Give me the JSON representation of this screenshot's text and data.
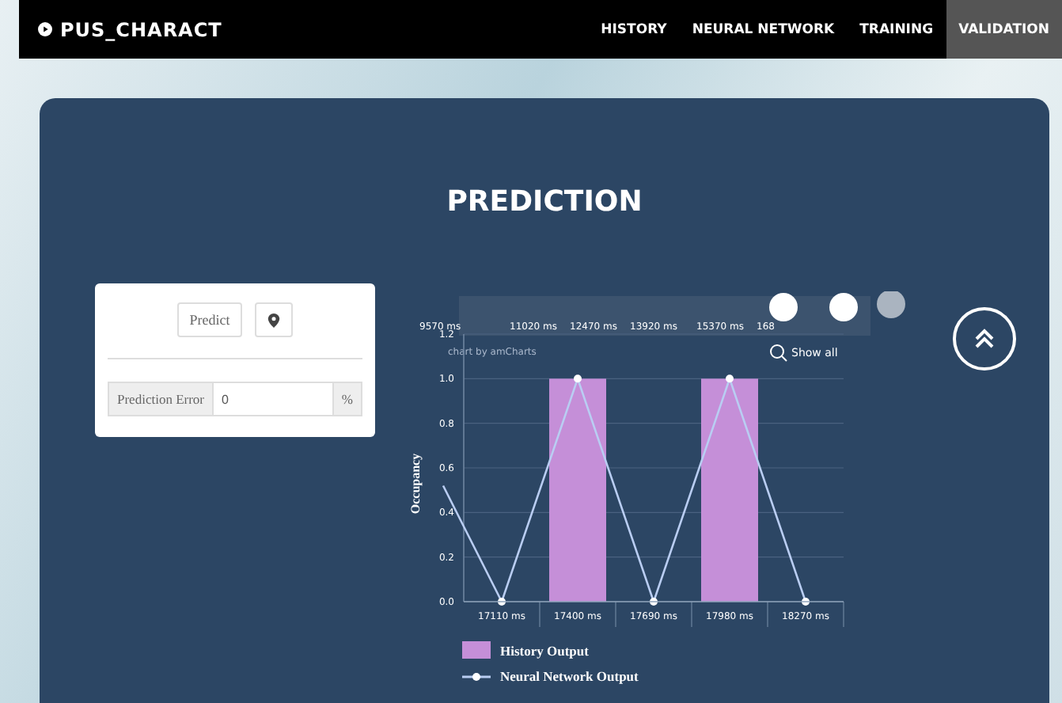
{
  "navbar": {
    "brand": "PUS_CHARACT",
    "links": [
      {
        "label": "HISTORY",
        "selected": false
      },
      {
        "label": "NEURAL NETWORK",
        "selected": false
      },
      {
        "label": "TRAINING",
        "selected": false
      },
      {
        "label": "VALIDATION",
        "selected": true
      }
    ]
  },
  "section": {
    "title": "PREDICTION"
  },
  "predict_card": {
    "predict_button": "Predict",
    "error_label": "Prediction Error",
    "error_value": "0",
    "error_unit": "%"
  },
  "chart": {
    "credit": "chart by amCharts",
    "show_all": "Show all",
    "scrollbar_labels": [
      "9570 ms",
      "11020 ms",
      "12470 ms",
      "13920 ms",
      "15370 ms",
      "168"
    ],
    "chart_data": {
      "type": "bar",
      "grid": true,
      "ylabel": "Occupancy",
      "categories": [
        "17110 ms",
        "17400 ms",
        "17690 ms",
        "17980 ms",
        "18270 ms"
      ],
      "ylim": [
        0,
        1.2
      ],
      "yticks": [
        {
          "value": 0,
          "label": "0.0"
        },
        {
          "value": 0.2,
          "label": "0.2"
        },
        {
          "value": 0.4,
          "label": "0.4"
        },
        {
          "value": 0.6,
          "label": "0.6"
        },
        {
          "value": 0.8,
          "label": "0.8"
        },
        {
          "value": 1,
          "label": "1.0"
        },
        {
          "value": 1.2,
          "label": "1.2"
        }
      ],
      "series": [
        {
          "name": "History Output",
          "color": "#c58fd8",
          "type": "bar",
          "values": [
            0,
            1,
            0,
            1,
            0
          ]
        },
        {
          "name": "Neural Network Output",
          "color": "#b9cdf2",
          "type": "line",
          "marker": true,
          "values": [
            0,
            1,
            0,
            1,
            0
          ]
        }
      ]
    }
  }
}
